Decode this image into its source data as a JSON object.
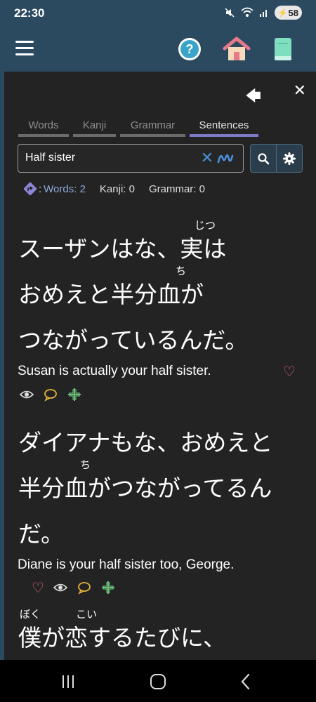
{
  "status": {
    "time": "22:30",
    "battery": "58"
  },
  "tabs": [
    {
      "label": "Words",
      "active": false
    },
    {
      "label": "Kanji",
      "active": false
    },
    {
      "label": "Grammar",
      "active": false
    },
    {
      "label": "Sentences",
      "active": true
    }
  ],
  "search": {
    "value": "Half sister"
  },
  "counts": {
    "words": "Words: 2",
    "kanji": "Kanji: 0",
    "grammar": "Grammar: 0"
  },
  "sentences": [
    {
      "lines": [
        "スーザンはな、実は",
        "おめえと半分血が",
        "つながっているんだ。"
      ],
      "furigana": [
        {
          "text": "じつ"
        },
        {
          "text": "ち"
        }
      ],
      "english": "Susan is actually your half sister."
    },
    {
      "lines": [
        "ダイアナもな、おめえと",
        "半分血がつながってるん",
        "だ。"
      ],
      "furigana": [
        {
          "text": "ち"
        }
      ],
      "english": "Diane is your half sister too, George."
    },
    {
      "lines": [
        "僕が恋するたびに、"
      ],
      "furigana": [
        {
          "text": "ぼく"
        },
        {
          "text": "こい"
        }
      ]
    }
  ],
  "colors": {
    "header": "#2b4a5f",
    "content_bg": "#232323",
    "active_tab_underline": "#7d7bc8",
    "heart": "#e06a7a",
    "comment": "#e2b33a",
    "plus": "#6bbf7a"
  }
}
